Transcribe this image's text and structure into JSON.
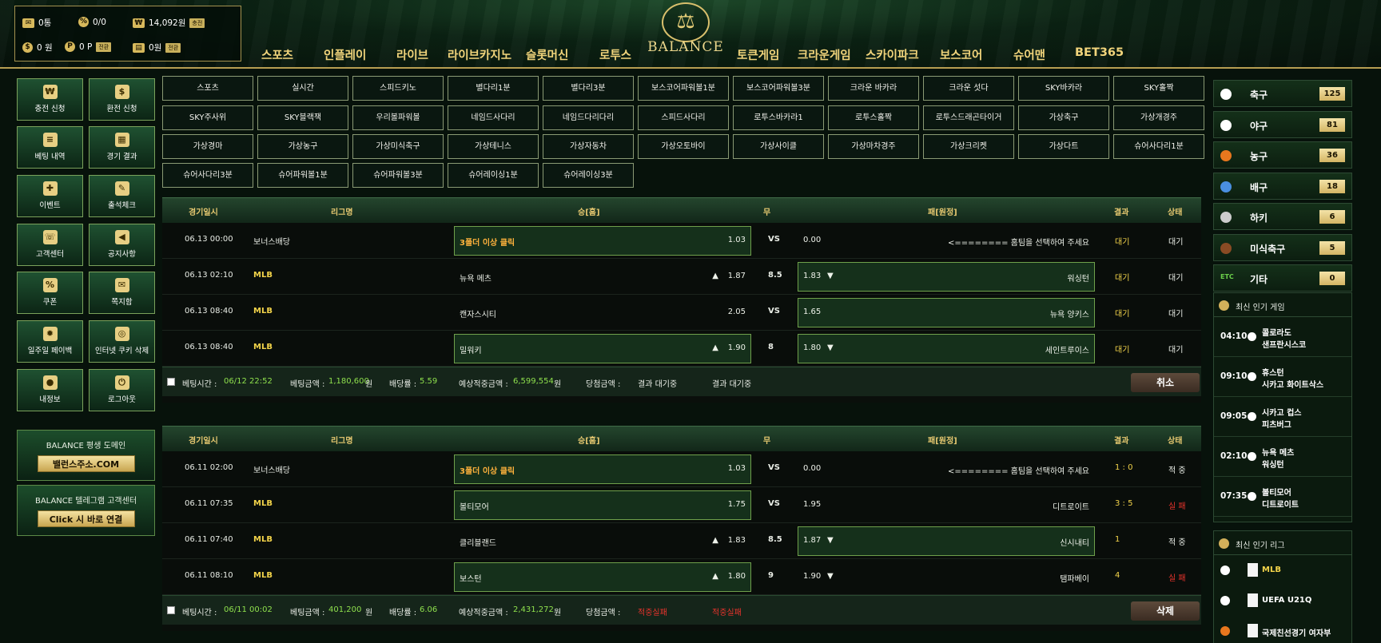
{
  "wallet": {
    "msg": "0통",
    "coupon": "0/0",
    "money": "14,092원",
    "money_btn": "충전",
    "cash": "0 원",
    "point": "0 P",
    "point_btn": "전환",
    "casino": "0원",
    "casino_btn": "전환"
  },
  "logo": {
    "text": "BALANCE"
  },
  "nav": [
    "스포츠",
    "인플레이",
    "라이브",
    "라이브카지노",
    "슬롯머신",
    "로투스",
    "토큰게임",
    "크라운게임",
    "스카이파크",
    "보스코어",
    "슈어맨",
    "BET365"
  ],
  "left_menu": [
    "충전 신청",
    "환전 신청",
    "베팅 내역",
    "경기 결과",
    "이벤트",
    "출석체크",
    "고객센터",
    "공지사항",
    "쿠폰",
    "쪽지함",
    "일주일 페이백",
    "인터넷 쿠키 삭제",
    "내정보",
    "로그아웃"
  ],
  "promos": [
    {
      "title": "BALANCE 평생 도메인",
      "button": "밸런스주소.COM"
    },
    {
      "title": "BALANCE 텔레그램 고객센터",
      "button": "Click 시 바로 연결"
    }
  ],
  "games": [
    "스포츠",
    "실시간",
    "스피드키노",
    "별다리1분",
    "별다리3분",
    "보스코어파워볼1분",
    "보스코어파워볼3분",
    "크라운 바카라",
    "크라운 섯다",
    "SKY바카라",
    "SKY홀짝",
    "SKY주사위",
    "SKY블랙잭",
    "우리볼파워볼",
    "네임드사다리",
    "네임드다리다리",
    "스피드사다리",
    "로투스바카라1",
    "로투스홀짝",
    "로투스드래곤타이거",
    "가상축구",
    "가상개경주",
    "가상경마",
    "가상농구",
    "가상미식축구",
    "가상테니스",
    "가상자동차",
    "가상오토바이",
    "가상사이클",
    "가상마차경주",
    "가상크리켓",
    "가상다트",
    "슈어사다리1분",
    "슈어사다리3분",
    "슈어파워볼1분",
    "슈어파워볼3분",
    "슈어레이싱1분",
    "슈어레이싱3분"
  ],
  "table_headers": {
    "time": "경기일시",
    "league": "리그명",
    "home": "승[홈]",
    "draw": "무",
    "away": "패[원정]",
    "result": "결과",
    "status": "상태"
  },
  "slips": [
    {
      "rows": [
        {
          "time": "06.13 00:00",
          "league": "보너스배당",
          "home": "3폴더 이상 클릭",
          "home_odds": "1.03",
          "mid": "VS",
          "away_odds": "0.00",
          "away": "<======== 홈팀을 선택하여 주세요",
          "result": "대기",
          "status": "대기"
        },
        {
          "time": "06.13 02:10",
          "league": "MLB",
          "home": "뉴욕 메츠",
          "home_odds": "1.87",
          "mid": "8.5",
          "away_odds": "1.83",
          "away": "워싱턴",
          "result": "대기",
          "status": "대기"
        },
        {
          "time": "06.13 08:40",
          "league": "MLB",
          "home": "캔자스시티",
          "home_odds": "2.05",
          "mid": "VS",
          "away_odds": "1.65",
          "away": "뉴욕 양키스",
          "result": "대기",
          "status": "대기"
        },
        {
          "time": "06.13 08:40",
          "league": "MLB",
          "home": "밀워키",
          "home_odds": "1.90",
          "mid": "8",
          "away_odds": "1.80",
          "away": "세인트루이스",
          "result": "대기",
          "status": "대기"
        }
      ],
      "footer": {
        "time_label": "베팅시간 :",
        "time": "06/12 22:52",
        "amount_label": "베팅금액 :",
        "amount": "1,180,600",
        "unit": "원",
        "odds_label": "배당률 :",
        "odds": "5.59",
        "expected_label": "예상적중금액 :",
        "expected": "6,599,554",
        "win_label": "당첨금액 :",
        "win": "결과 대기중",
        "note": "결과 대기중",
        "button": "취소"
      }
    },
    {
      "rows": [
        {
          "time": "06.11 02:00",
          "league": "보너스배당",
          "home": "3폴더 이상 클릭",
          "home_odds": "1.03",
          "mid": "VS",
          "away_odds": "0.00",
          "away": "<======== 홈팀을 선택하여 주세요",
          "result": "1 : 0",
          "status": "적 중"
        },
        {
          "time": "06.11 07:35",
          "league": "MLB",
          "home": "볼티모어",
          "home_odds": "1.75",
          "mid": "VS",
          "away_odds": "1.95",
          "away": "디트로이트",
          "result": "3 : 5",
          "status": "실 패"
        },
        {
          "time": "06.11 07:40",
          "league": "MLB",
          "home": "클리블랜드",
          "home_odds": "1.83",
          "mid": "8.5",
          "away_odds": "1.87",
          "away": "신시내티",
          "result": "1",
          "status": "적 중"
        },
        {
          "time": "06.11 08:10",
          "league": "MLB",
          "home": "보스턴",
          "home_odds": "1.80",
          "mid": "9",
          "away_odds": "1.90",
          "away": "탬파베이",
          "result": "4",
          "status": "실 패"
        }
      ],
      "footer": {
        "time_label": "베팅시간 :",
        "time": "06/11 00:02",
        "amount_label": "베팅금액 :",
        "amount": "401,200",
        "unit": "원",
        "odds_label": "배당률 :",
        "odds": "6.06",
        "expected_label": "예상적중금액 :",
        "expected": "2,431,272",
        "win_label": "당첨금액 :",
        "win": "적중실패",
        "note": "적중실패",
        "button": "삭제"
      }
    }
  ],
  "sports": [
    {
      "name": "축구",
      "count": "125",
      "icon": "soccer-ball-icon",
      "color": "#ffffff"
    },
    {
      "name": "야구",
      "count": "81",
      "icon": "baseball-icon",
      "color": "#ffffff"
    },
    {
      "name": "농구",
      "count": "36",
      "icon": "basketball-icon",
      "color": "#e8771e"
    },
    {
      "name": "배구",
      "count": "18",
      "icon": "volleyball-icon",
      "color": "#4a8fe0"
    },
    {
      "name": "하키",
      "count": "6",
      "icon": "hockey-stick-icon",
      "color": "#cccccc"
    },
    {
      "name": "미식축구",
      "count": "5",
      "icon": "football-icon",
      "color": "#8a4b24"
    },
    {
      "name": "기타",
      "count": "0",
      "icon": "etc-icon",
      "color": "#6bd04a"
    }
  ],
  "etc_label": "ETC",
  "popular_games": {
    "title": "최신 인기 게임",
    "items": [
      {
        "time": "04:10",
        "team1": "콜로라도",
        "team2": "샌프란시스코"
      },
      {
        "time": "09:10",
        "team1": "휴스턴",
        "team2": "시카고 화이트삭스"
      },
      {
        "time": "09:05",
        "team1": "시카고 컵스",
        "team2": "피츠버그"
      },
      {
        "time": "02:10",
        "team1": "뉴욕 메츠",
        "team2": "워싱턴"
      },
      {
        "time": "07:35",
        "team1": "볼티모어",
        "team2": "디트로이트"
      }
    ]
  },
  "popular_leagues": {
    "title": "최신 인기 리그",
    "items": [
      {
        "name": "MLB"
      },
      {
        "name": "UEFA U21Q"
      },
      {
        "name": "국제친선경기 여자부"
      }
    ]
  }
}
